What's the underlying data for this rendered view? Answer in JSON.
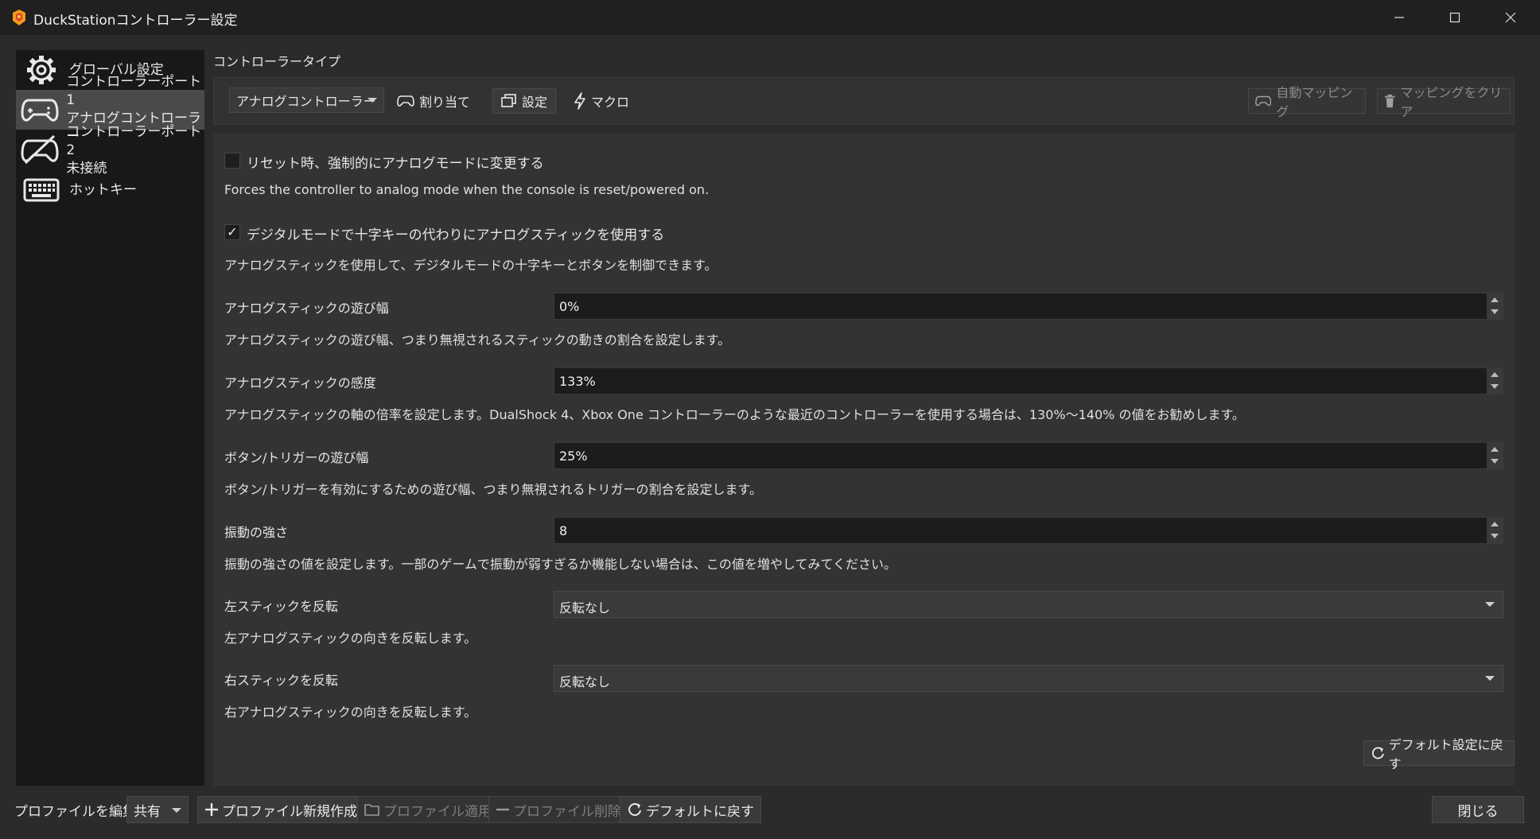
{
  "window": {
    "title": "DuckStationコントローラー設定",
    "minimize_glyph": "—",
    "maximize_glyph": "☐",
    "close_glyph": "✕"
  },
  "sidebar": {
    "items": [
      {
        "line1": "グローバル設定",
        "line2": "",
        "icon": "gear-icon"
      },
      {
        "line1": "コントローラーポート 1",
        "line2": "アナログコントローラー",
        "icon": "gamepad-icon",
        "selected": true
      },
      {
        "line1": "コントローラーポート 2",
        "line2": "未接続",
        "icon": "gamepad-disconnected-icon"
      },
      {
        "line1": "ホットキー",
        "line2": "",
        "icon": "keyboard-icon"
      }
    ]
  },
  "main": {
    "controller_type_label": "コントローラータイプ",
    "toolbar": {
      "controller_type_value": "アナログコントローラー",
      "bindings_label": "割り当て",
      "settings_label": "設定",
      "macros_label": "マクロ",
      "auto_mapping_label": "自動マッピング",
      "clear_mapping_label": "マッピングをクリア"
    },
    "settings": {
      "force_analog": {
        "label": "リセット時、強制的にアナログモードに変更する",
        "checked": false,
        "description": "Forces the controller to analog mode when the console is reset/powered on."
      },
      "analog_dpad": {
        "label": "デジタルモードで十字キーの代わりにアナログスティックを使用する",
        "checked": true,
        "check_glyph": "✓",
        "description": "アナログスティックを使用して、デジタルモードの十字キーとボタンを制御できます。"
      },
      "deadzone": {
        "label": "アナログスティックの遊び幅",
        "value": "0%",
        "description": "アナログスティックの遊び幅、つまり無視されるスティックの動きの割合を設定します。"
      },
      "sensitivity": {
        "label": "アナログスティックの感度",
        "value": "133%",
        "description": "アナログスティックの軸の倍率を設定します。DualShock 4、Xbox One コントローラーのような最近のコントローラーを使用する場合は、130%～140% の値をお勧めします。"
      },
      "button_deadzone": {
        "label": "ボタン/トリガーの遊び幅",
        "value": "25%",
        "description": "ボタン/トリガーを有効にするための遊び幅、つまり無視されるトリガーの割合を設定します。"
      },
      "vibration": {
        "label": "振動の強さ",
        "value": "8",
        "description": "振動の強さの値を設定します。一部のゲームで振動が弱すぎるか機能しない場合は、この値を増やしてみてください。"
      },
      "invert_left": {
        "label": "左スティックを反転",
        "value": "反転なし",
        "description": "左アナログスティックの向きを反転します。"
      },
      "invert_right": {
        "label": "右スティックを反転",
        "value": "反転なし",
        "description": "右アナログスティックの向きを反転します。"
      }
    },
    "restore_defaults_label": "デフォルト設定に戻す"
  },
  "bottom": {
    "profile_label": "プロファイルを編集:",
    "profile_value": "共有",
    "new_profile_label": "プロファイル新規作成",
    "apply_profile_label": "プロファイル適用",
    "delete_profile_label": "プロファイル削除",
    "restore_defaults_label": "デフォルトに戻す",
    "close_label": "閉じる"
  },
  "colors": {
    "background": "#2b2b2b",
    "sidebar": "#181818",
    "selected": "#4a4a4a",
    "panel": "#333333"
  }
}
